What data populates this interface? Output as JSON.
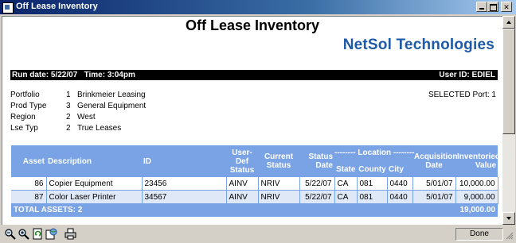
{
  "window": {
    "title": "Off Lease Inventory"
  },
  "report": {
    "title": "Off Lease Inventory",
    "company": "NetSol Technologies",
    "run_info": "Run date: 5/22/07   Time: 3:04pm",
    "user_id": "User ID: EDIEL",
    "selected_port": "SELECTED Port: 1",
    "params": [
      {
        "label": "Portfolio",
        "code": "1",
        "value": "Brinkmeier Leasing"
      },
      {
        "label": "Prod Type",
        "code": "3",
        "value": "General Equipment"
      },
      {
        "label": "Region",
        "code": "2",
        "value": "West"
      },
      {
        "label": "Lse Typ",
        "code": "2",
        "value": "True Leases"
      }
    ]
  },
  "table": {
    "headers": {
      "asset": "Asset",
      "description": "Description",
      "id": "ID",
      "user_def_status": "User-Def Status",
      "current_status": "Current Status",
      "status_date": "Status Date",
      "location": "-------- Location --------",
      "state": "State",
      "county": "County",
      "city": "City",
      "acquisition_date": "Acquisition Date",
      "inventoried_value": "Inventoried Value"
    },
    "rows": [
      {
        "asset": "86",
        "description": "Copier Equipment",
        "id": "23456",
        "user_def_status": "AINV",
        "current_status": "NRIV",
        "status_date": "5/22/07",
        "state": "CA",
        "county": "081",
        "city": "0440",
        "acquisition_date": "5/01/07",
        "inventoried_value": "10,000.00"
      },
      {
        "asset": "87",
        "description": "Color Laser Printer",
        "id": "34567",
        "user_def_status": "AINV",
        "current_status": "NRIV",
        "status_date": "5/22/07",
        "state": "CA",
        "county": "081",
        "city": "0440",
        "acquisition_date": "5/01/07",
        "inventoried_value": "9,000.00"
      }
    ],
    "total_label": "TOTAL ASSETS: 2",
    "total_value": "19,000.00"
  },
  "statusbar": {
    "done_label": "Done"
  },
  "icons": [
    "zoom-out-icon",
    "zoom-in-icon",
    "refresh-icon",
    "globe-icon",
    "print-icon"
  ],
  "colors": {
    "header_blue": "#7aa3e6",
    "logo_blue": "#1e5aa8",
    "row_alt": "#dfe8f7"
  }
}
